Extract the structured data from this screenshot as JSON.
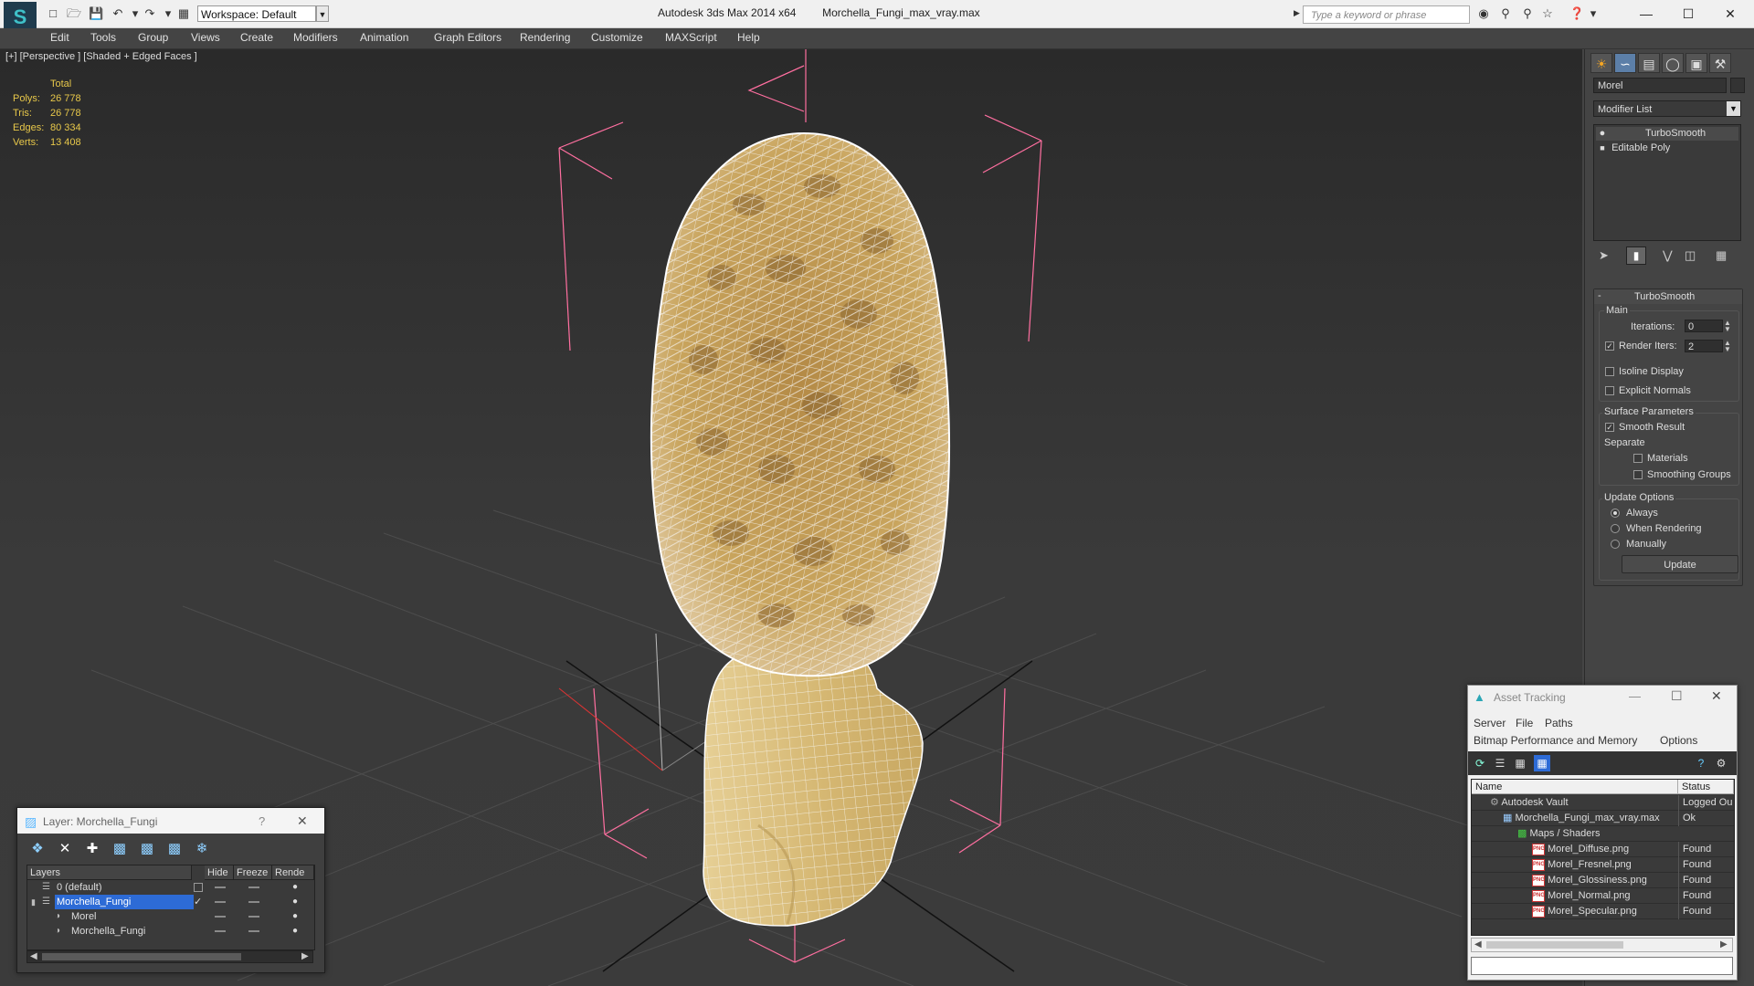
{
  "titlebar": {
    "app_title": "Autodesk 3ds Max  2014 x64",
    "file_title": "Morchella_Fungi_max_vray.max",
    "workspace_label": "Workspace: Default",
    "search_placeholder": "Type a keyword or phrase",
    "minimize": "—",
    "maximize": "☐",
    "close": "✕"
  },
  "menu": [
    "Edit",
    "Tools",
    "Group",
    "Views",
    "Create",
    "Modifiers",
    "Animation",
    "Graph Editors",
    "Rendering",
    "Customize",
    "MAXScript",
    "Help"
  ],
  "viewport": {
    "label": "[+] [Perspective ] [Shaded + Edged Faces ]",
    "stats": {
      "header": "Total",
      "rows": [
        {
          "label": "Polys:",
          "value": "26 778"
        },
        {
          "label": "Tris:",
          "value": "26 778"
        },
        {
          "label": "Edges:",
          "value": "80 334"
        },
        {
          "label": "Verts:",
          "value": "13 408"
        }
      ]
    }
  },
  "command_panel": {
    "object_name": "Morel",
    "modifier_list": "Modifier List",
    "stack": [
      "TurboSmooth",
      "Editable Poly"
    ],
    "turbosmooth": {
      "title": "TurboSmooth",
      "main": "Main",
      "iterations_label": "Iterations:",
      "iterations_value": "0",
      "render_iters_label": "Render Iters:",
      "render_iters_value": "2",
      "isoline": "Isoline Display",
      "explicit_normals": "Explicit Normals",
      "surface_params": "Surface Parameters",
      "smooth_result": "Smooth Result",
      "separate": "Separate",
      "materials": "Materials",
      "smoothing_groups": "Smoothing Groups",
      "update_options": "Update Options",
      "always": "Always",
      "when_rendering": "When Rendering",
      "manually": "Manually",
      "update_button": "Update"
    }
  },
  "layer_window": {
    "title": "Layer: Morchella_Fungi",
    "help": "?",
    "close": "✕",
    "columns": [
      "Layers",
      "Hide",
      "Freeze",
      "Rende"
    ],
    "rows": [
      {
        "name": "0 (default)",
        "indent": 0
      },
      {
        "name": "Morchella_Fungi",
        "indent": 0,
        "selected": true
      },
      {
        "name": "Morel",
        "indent": 1
      },
      {
        "name": "Morchella_Fungi",
        "indent": 1
      }
    ]
  },
  "asset_window": {
    "title": "Asset Tracking",
    "menu1": [
      "Server",
      "File",
      "Paths"
    ],
    "menu2": [
      "Bitmap Performance and Memory",
      "Options"
    ],
    "columns": [
      "Name",
      "Status"
    ],
    "rows": [
      {
        "name": "Autodesk Vault",
        "status": "Logged Ou",
        "indent": 1
      },
      {
        "name": "Morchella_Fungi_max_vray.max",
        "status": "Ok",
        "indent": 2
      },
      {
        "name": "Maps / Shaders",
        "status": "",
        "indent": 3
      },
      {
        "name": "Morel_Diffuse.png",
        "status": "Found",
        "indent": 4
      },
      {
        "name": "Morel_Fresnel.png",
        "status": "Found",
        "indent": 4
      },
      {
        "name": "Morel_Glossiness.png",
        "status": "Found",
        "indent": 4
      },
      {
        "name": "Morel_Normal.png",
        "status": "Found",
        "indent": 4
      },
      {
        "name": "Morel_Specular.png",
        "status": "Found",
        "indent": 4
      }
    ]
  },
  "colors": {
    "selection": "#2d6bd6",
    "stat_text": "#e8c84a",
    "gizmo": "#ff6fa0",
    "mesh_base": "#c9a55e",
    "wire": "#f4efe6"
  }
}
